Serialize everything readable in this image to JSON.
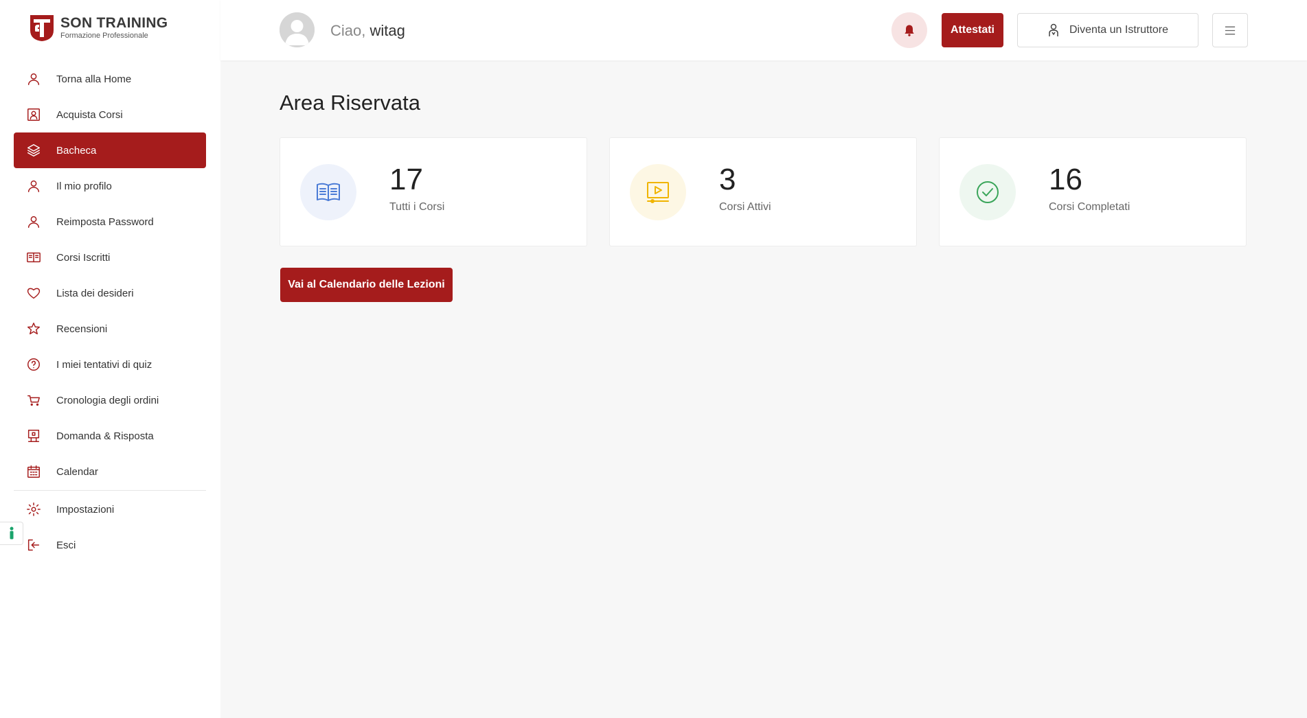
{
  "brand": {
    "title": "SON TRAINING",
    "subtitle": "Formazione Professionale",
    "accent": "#a51c1c"
  },
  "sidebar": {
    "items": [
      {
        "label": "Torna alla Home",
        "icon": "user-icon"
      },
      {
        "label": "Acquista Corsi",
        "icon": "portrait-icon"
      },
      {
        "label": "Bacheca",
        "icon": "layers-icon",
        "active": true
      },
      {
        "label": "Il mio profilo",
        "icon": "user-icon"
      },
      {
        "label": "Reimposta Password",
        "icon": "user-icon"
      },
      {
        "label": "Corsi Iscritti",
        "icon": "book-icon"
      },
      {
        "label": "Lista dei desideri",
        "icon": "heart-icon"
      },
      {
        "label": "Recensioni",
        "icon": "star-icon"
      },
      {
        "label": "I miei tentativi di quiz",
        "icon": "question-icon"
      },
      {
        "label": "Cronologia degli ordini",
        "icon": "cart-icon"
      },
      {
        "label": "Domanda & Risposta",
        "icon": "qa-icon"
      },
      {
        "label": "Calendar",
        "icon": "calendar-icon"
      }
    ],
    "bottom_items": [
      {
        "label": "Impostazioni",
        "icon": "gear-icon"
      },
      {
        "label": "Esci",
        "icon": "logout-icon"
      }
    ]
  },
  "header": {
    "greeting_prefix": "Ciao,",
    "username": "witag",
    "attestati_label": "Attestati",
    "istruttore_label": "Diventa un Istruttore"
  },
  "main": {
    "title": "Area Riservata",
    "cards": [
      {
        "value": "17",
        "label": "Tutti i Corsi",
        "icon": "open-book-icon",
        "color": "#4a7bd6",
        "bg": "#eef2fb"
      },
      {
        "value": "3",
        "label": "Corsi Attivi",
        "icon": "video-lesson-icon",
        "color": "#f0b400",
        "bg": "#fdf7e4"
      },
      {
        "value": "16",
        "label": "Corsi Completati",
        "icon": "check-circle-icon",
        "color": "#3aa55a",
        "bg": "#eef7f0"
      }
    ],
    "calendar_button": "Vai al Calendario delle Lezioni"
  }
}
